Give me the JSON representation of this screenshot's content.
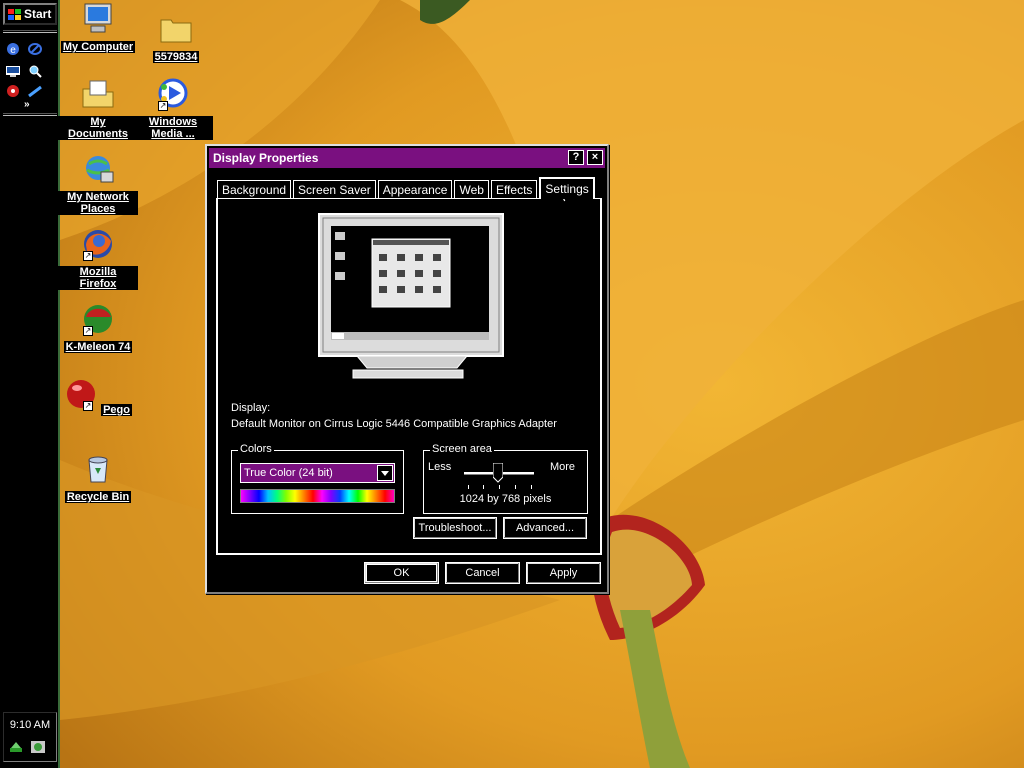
{
  "taskbar": {
    "start_label": "Start",
    "clock": "9:10 AM",
    "quicklaunch_more": "»",
    "quicklaunch_icons": [
      "internet-explorer-icon",
      "outlook-express-icon",
      "show-desktop-icon",
      "search-icon",
      "media-icon",
      "channel-icon"
    ]
  },
  "desktop": {
    "icons": [
      {
        "name": "my-computer",
        "label": "My Computer"
      },
      {
        "name": "folder-5579834",
        "label": "5579834"
      },
      {
        "name": "my-documents",
        "label": "My Documents"
      },
      {
        "name": "windows-media",
        "label": "Windows Media ..."
      },
      {
        "name": "my-network-places",
        "label": "My Network Places"
      },
      {
        "name": "mozilla-firefox",
        "label": "Mozilla Firefox"
      },
      {
        "name": "k-meleon",
        "label": "K-Meleon 74"
      },
      {
        "name": "pego",
        "label": "Pego"
      },
      {
        "name": "recycle-bin",
        "label": "Recycle Bin"
      }
    ]
  },
  "dialog": {
    "title": "Display Properties",
    "help_btn": "?",
    "close_btn": "×",
    "tabs": [
      {
        "label": "Background"
      },
      {
        "label": "Screen Saver"
      },
      {
        "label": "Appearance"
      },
      {
        "label": "Web"
      },
      {
        "label": "Effects"
      },
      {
        "label": "Settings"
      }
    ],
    "active_tab": "Settings",
    "display_label": "Display:",
    "display_value": "Default Monitor on Cirrus Logic 5446 Compatible Graphics Adapter",
    "colors": {
      "title": "Colors",
      "selected": "True Color (24 bit)"
    },
    "screen_area": {
      "title": "Screen area",
      "less": "Less",
      "more": "More",
      "value": "1024 by 768 pixels",
      "slider_level": 0.5
    },
    "buttons": {
      "troubleshoot": "Troubleshoot...",
      "advanced": "Advanced...",
      "ok": "OK",
      "cancel": "Cancel",
      "apply": "Apply"
    }
  },
  "colors": {
    "titlebar": "#7a1080",
    "wallpaper": "#e6a02a",
    "selection": "#7a1080"
  }
}
